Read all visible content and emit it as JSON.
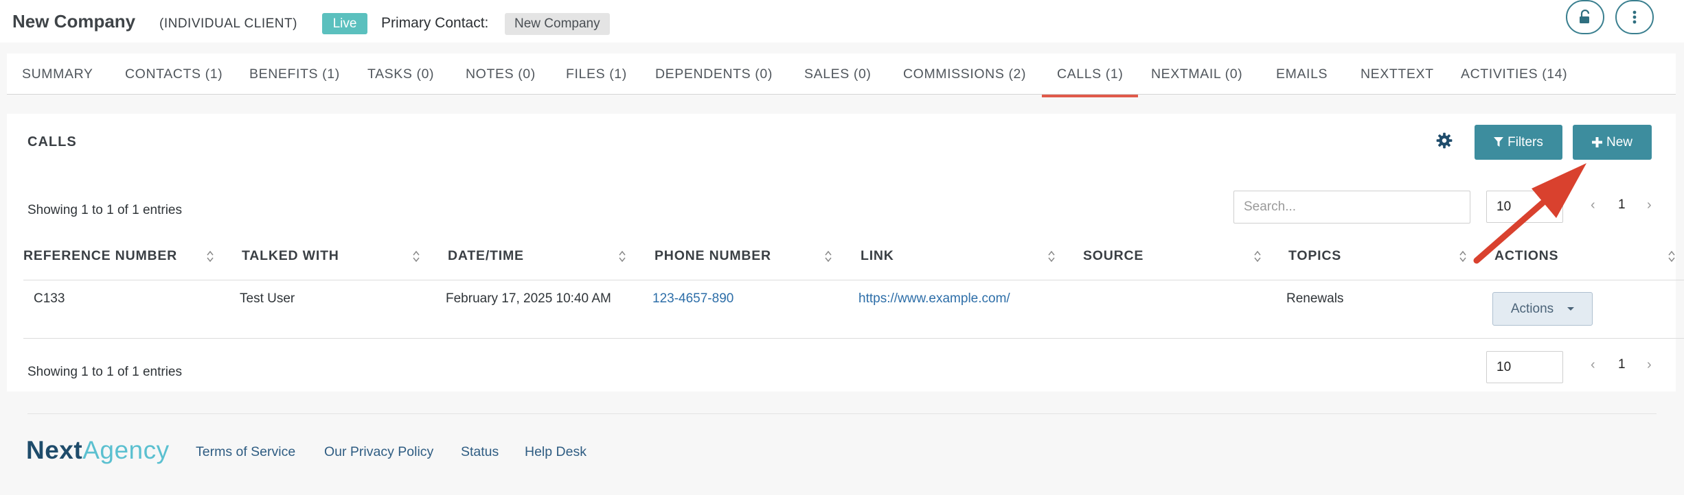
{
  "header": {
    "company_name": "New Company",
    "client_type": "(INDIVIDUAL CLIENT)",
    "status_badge": "Live",
    "primary_contact_label": "Primary Contact:",
    "primary_contact_value": "New Company",
    "icons": [
      "unlock-icon",
      "more-vertical-icon"
    ]
  },
  "tabs": [
    {
      "label": "SUMMARY",
      "active": false
    },
    {
      "label": "CONTACTS (1)",
      "active": false
    },
    {
      "label": "BENEFITS (1)",
      "active": false
    },
    {
      "label": "TASKS (0)",
      "active": false
    },
    {
      "label": "NOTES (0)",
      "active": false
    },
    {
      "label": "FILES (1)",
      "active": false
    },
    {
      "label": "DEPENDENTS (0)",
      "active": false
    },
    {
      "label": "SALES (0)",
      "active": false
    },
    {
      "label": "COMMISSIONS (2)",
      "active": false
    },
    {
      "label": "CALLS (1)",
      "active": true
    },
    {
      "label": "NEXTMAIL (0)",
      "active": false
    },
    {
      "label": "EMAILS",
      "active": false
    },
    {
      "label": "NEXTTEXT",
      "active": false
    },
    {
      "label": "ACTIVITIES (14)",
      "active": false
    }
  ],
  "calls": {
    "title": "CALLS",
    "filters_label": "Filters",
    "new_label": "New",
    "showing_top": "Showing 1 to 1 of 1 entries",
    "showing_bottom": "Showing 1 to 1 of 1 entries",
    "search_placeholder": "Search...",
    "page_size": "10",
    "current_page": "1",
    "columns": [
      "REFERENCE NUMBER",
      "TALKED WITH",
      "DATE/TIME",
      "PHONE NUMBER",
      "LINK",
      "SOURCE",
      "TOPICS",
      "ACTIONS"
    ],
    "rows": [
      {
        "reference": "C133",
        "talked_with": "Test User",
        "datetime": "February 17, 2025 10:40 AM",
        "phone": "123-4657-890",
        "link": "https://www.example.com/",
        "source": "",
        "topics": "Renewals",
        "actions_label": "Actions"
      }
    ]
  },
  "footer": {
    "logo_part1": "Next",
    "logo_part2": "Agency",
    "links": [
      "Terms of Service",
      "Our Privacy Policy",
      "Status",
      "Help Desk"
    ]
  },
  "colors": {
    "accent_teal": "#3d8d9e",
    "live_badge": "#5bc0be",
    "active_tab_underline": "#e05a4a",
    "annotation_arrow": "#d9412e",
    "link_blue": "#2d6ea8"
  }
}
